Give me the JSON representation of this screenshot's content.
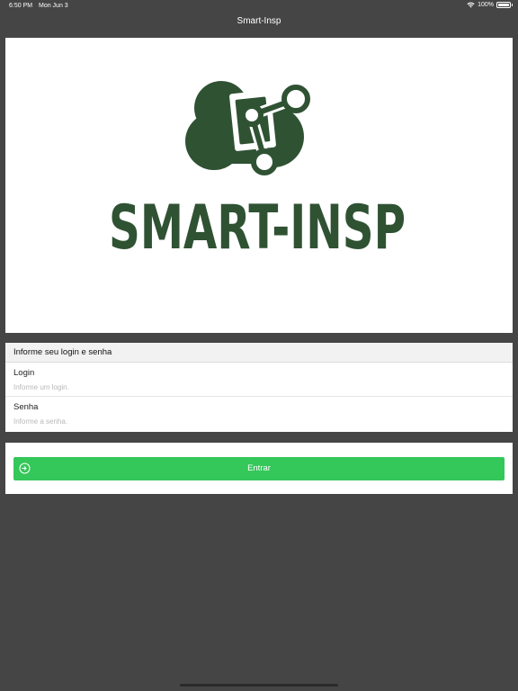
{
  "status_bar": {
    "time": "6:50 PM",
    "date": "Mon Jun 3",
    "battery": "100%",
    "icons": [
      "wifi-icon",
      "battery-icon"
    ]
  },
  "navbar": {
    "title": "Smart-Insp"
  },
  "logo": {
    "text": "SMART-INSP",
    "color": "#2f5233",
    "icon": "cloud-share-logo"
  },
  "login_form": {
    "header": "Informe seu login e senha",
    "fields": [
      {
        "label": "Login",
        "value": "",
        "placeholder": "Informe um login."
      },
      {
        "label": "Senha",
        "value": "",
        "placeholder": "Informe a senha."
      }
    ]
  },
  "actions": {
    "enter_label": "Entrar",
    "enter_icon": "login-arrow-icon",
    "button_color": "#34c759"
  }
}
